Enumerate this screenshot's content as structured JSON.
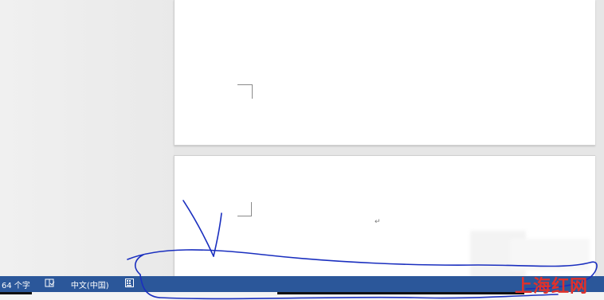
{
  "status_bar": {
    "word_count": "64 个字",
    "language": "中文(中国)",
    "proofing_icon": "book-check-icon",
    "macro_icon": "keyboard-icon",
    "background_color": "#2b579a"
  },
  "document": {
    "paragraph_mark": "↵"
  },
  "watermark": {
    "text": "上海红网",
    "color": "#e0312b"
  },
  "annotation": {
    "color": "#1a2fbf"
  }
}
